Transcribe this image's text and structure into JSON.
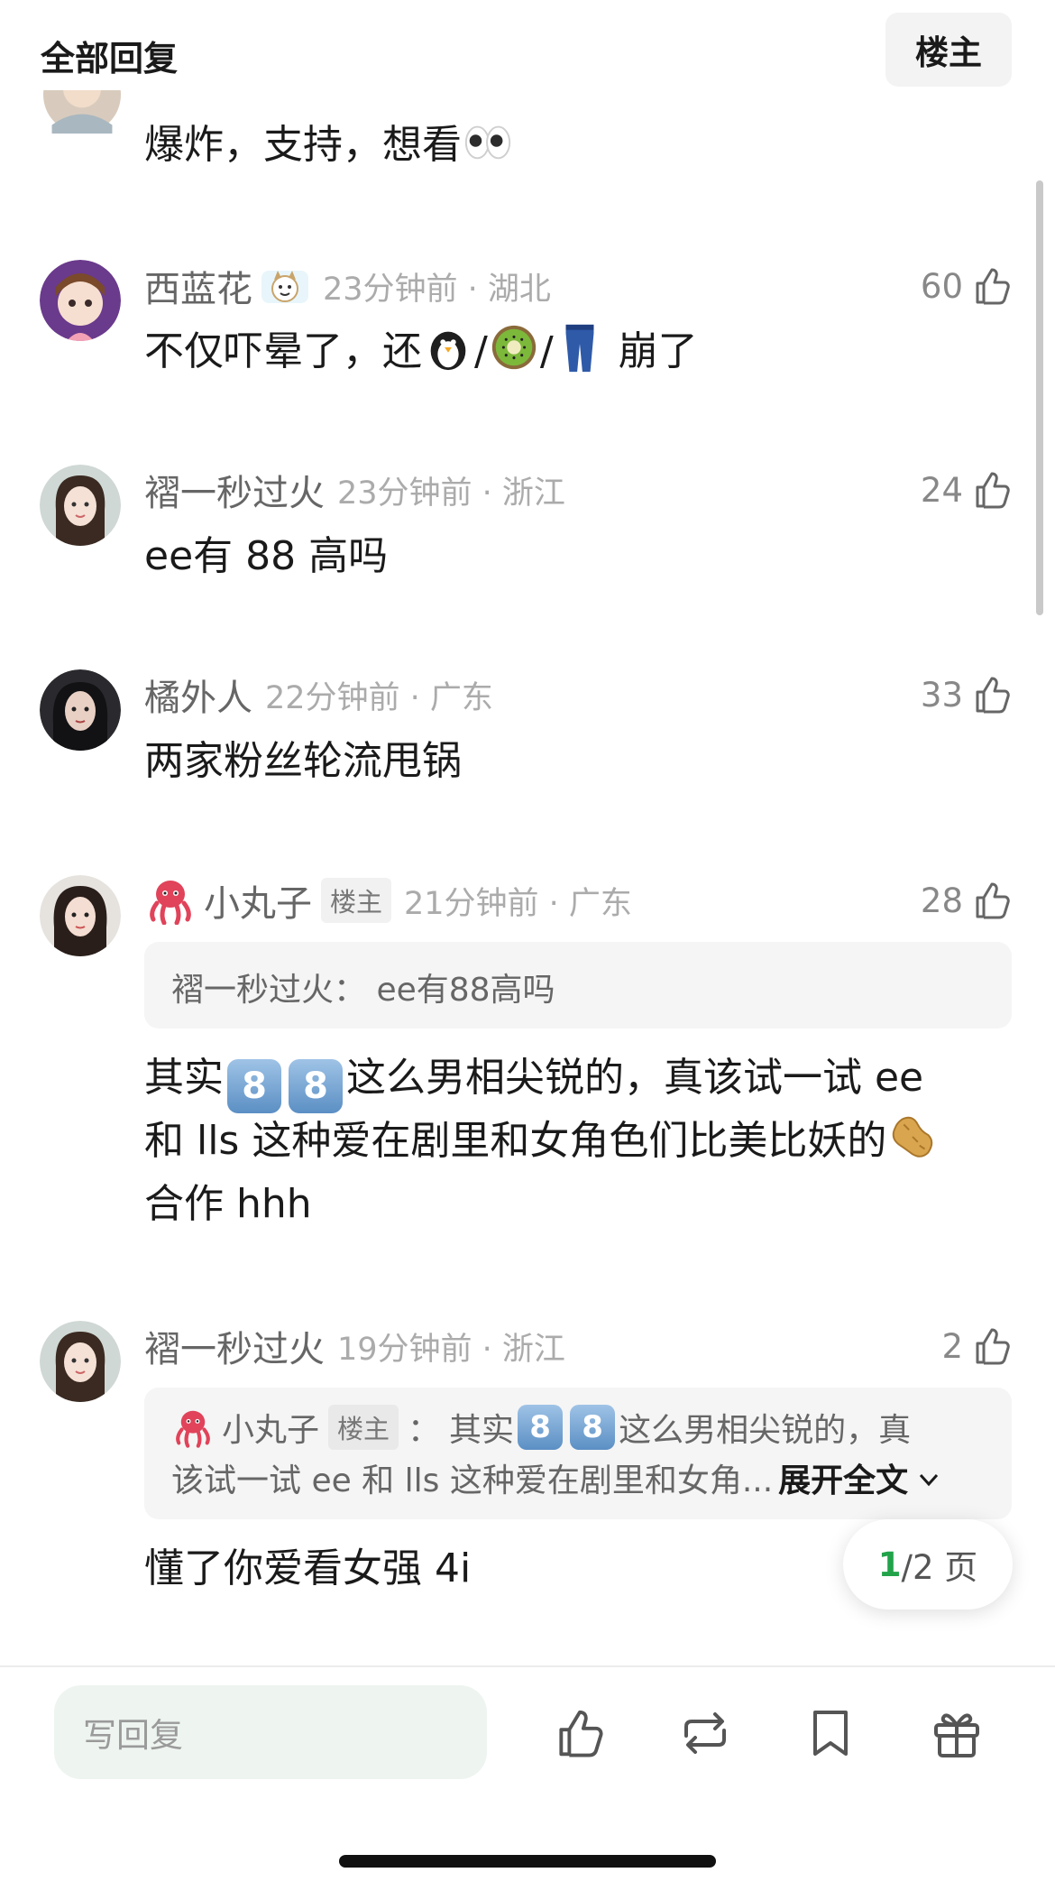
{
  "header": {
    "title": "全部回复",
    "owner_button": "楼主"
  },
  "partial_comment": {
    "text": "爆炸，支持，想看"
  },
  "comments": [
    {
      "username": "西蓝花",
      "time": "23分钟前 · 湖北",
      "likes": "60",
      "text_before": "不仅吓晕了，还",
      "sep1": "/",
      "sep2": "/",
      "text_after": " 崩了"
    },
    {
      "username": "褶一秒过火",
      "time": "23分钟前 · 浙江",
      "likes": "24",
      "text": "ee有 88 高吗"
    },
    {
      "username": "橘外人",
      "time": "22分钟前 · 广东",
      "likes": "33",
      "text": "两家粉丝轮流甩锅"
    },
    {
      "username": "小丸子",
      "owner_tag": "楼主",
      "time": "21分钟前 · 广东",
      "likes": "28",
      "quote": "褶一秒过火： ee有88高吗",
      "line1_before": "其实",
      "digit": "8",
      "line1_after": "这么男相尖锐的，真该试一试 ee",
      "line2": "和 lls 这种爱在剧里和女角色们比美比妖的",
      "line3": "合作 hhh"
    },
    {
      "username": "褶一秒过火",
      "time": "19分钟前 · 浙江",
      "likes": "2",
      "quote_user": "小丸子",
      "quote_tag": "楼主",
      "quote_colon": "：",
      "quote_line1_before": "其实",
      "quote_digit": "8",
      "quote_line1_after": "这么男相尖锐的，真",
      "quote_line2": "该试一试 ee 和 lls 这种爱在剧里和女角...",
      "expand": "展开全文",
      "text": "懂了你爱看女强 4i"
    }
  ],
  "pagination": {
    "current": "1",
    "total": "/2 页"
  },
  "bottom_bar": {
    "reply_placeholder": "写回复"
  },
  "colors": {
    "accent_green": "#22a34a",
    "text_primary": "#1a1a1a",
    "text_secondary": "#888888"
  },
  "icons": [
    "thumbs-up-icon",
    "repost-icon",
    "bookmark-icon",
    "gift-icon",
    "octopus-emoji",
    "penguin-emoji",
    "kiwi-emoji",
    "jeans-emoji",
    "eyes-emoji",
    "peanuts-emoji",
    "chevron-down-icon"
  ]
}
